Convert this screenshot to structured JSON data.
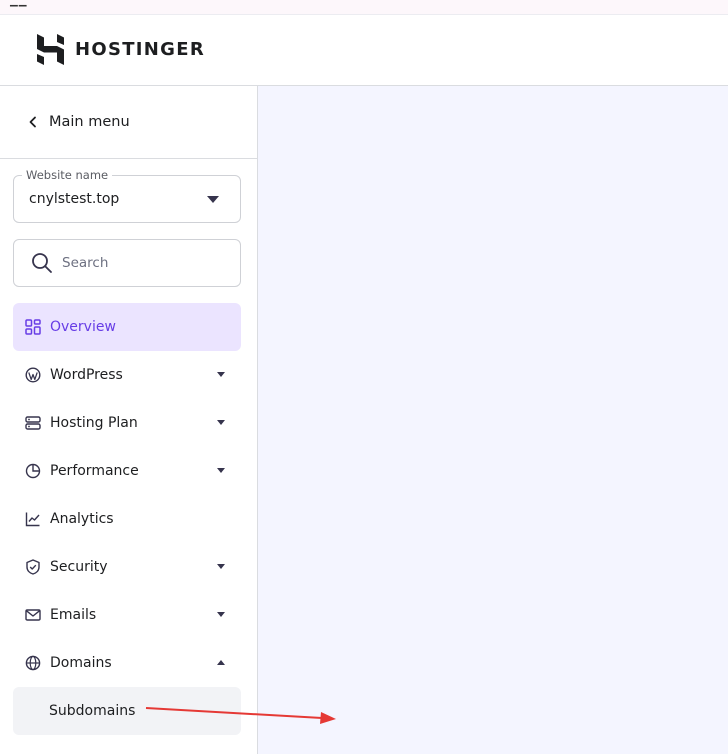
{
  "top_strip": {
    "glyph": "▁▁"
  },
  "brand": {
    "name": "HOSTINGER"
  },
  "sidebar": {
    "main_menu_label": "Main menu",
    "website_select": {
      "legend": "Website name",
      "value": "cnylstest.top"
    },
    "search": {
      "placeholder": "Search"
    },
    "items": [
      {
        "label": "Overview",
        "icon": "overview-grid-icon",
        "active": true
      },
      {
        "label": "WordPress",
        "icon": "wordpress-icon",
        "expandable": true
      },
      {
        "label": "Hosting Plan",
        "icon": "server-icon",
        "expandable": true
      },
      {
        "label": "Performance",
        "icon": "pie-chart-icon",
        "expandable": true
      },
      {
        "label": "Analytics",
        "icon": "line-chart-icon",
        "expandable": false
      },
      {
        "label": "Security",
        "icon": "shield-icon",
        "expandable": true
      },
      {
        "label": "Emails",
        "icon": "mail-icon",
        "expandable": true
      },
      {
        "label": "Domains",
        "icon": "globe-icon",
        "expandable": true,
        "expanded": true
      }
    ],
    "sub_items": [
      {
        "label": "Subdomains"
      }
    ]
  },
  "colors": {
    "accent": "#673de6",
    "active_bg": "#ebe4ff",
    "content_bg": "#f4f5ff",
    "annotation_arrow": "#e53935"
  }
}
